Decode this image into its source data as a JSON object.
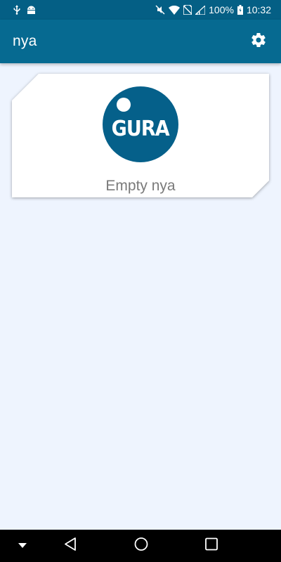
{
  "status_bar": {
    "battery_percent": "100%",
    "time": "10:32",
    "left_icons": [
      "usb-icon",
      "android-icon"
    ],
    "right_icons": [
      "mute-icon",
      "wifi-icon",
      "no-sim-icon",
      "signal-icon",
      "battery-icon"
    ]
  },
  "app_bar": {
    "title": "nya",
    "settings_icon": "gear-icon"
  },
  "card": {
    "avatar_text": "GURA",
    "empty_label": "Empty nya"
  },
  "nav_bar": {
    "items": [
      "keyboard-hide-icon",
      "back-icon",
      "home-icon",
      "recents-icon"
    ]
  },
  "colors": {
    "primary": "#066a91",
    "primary_dark": "#045f85",
    "background": "#eef4fe",
    "card": "#ffffff"
  }
}
